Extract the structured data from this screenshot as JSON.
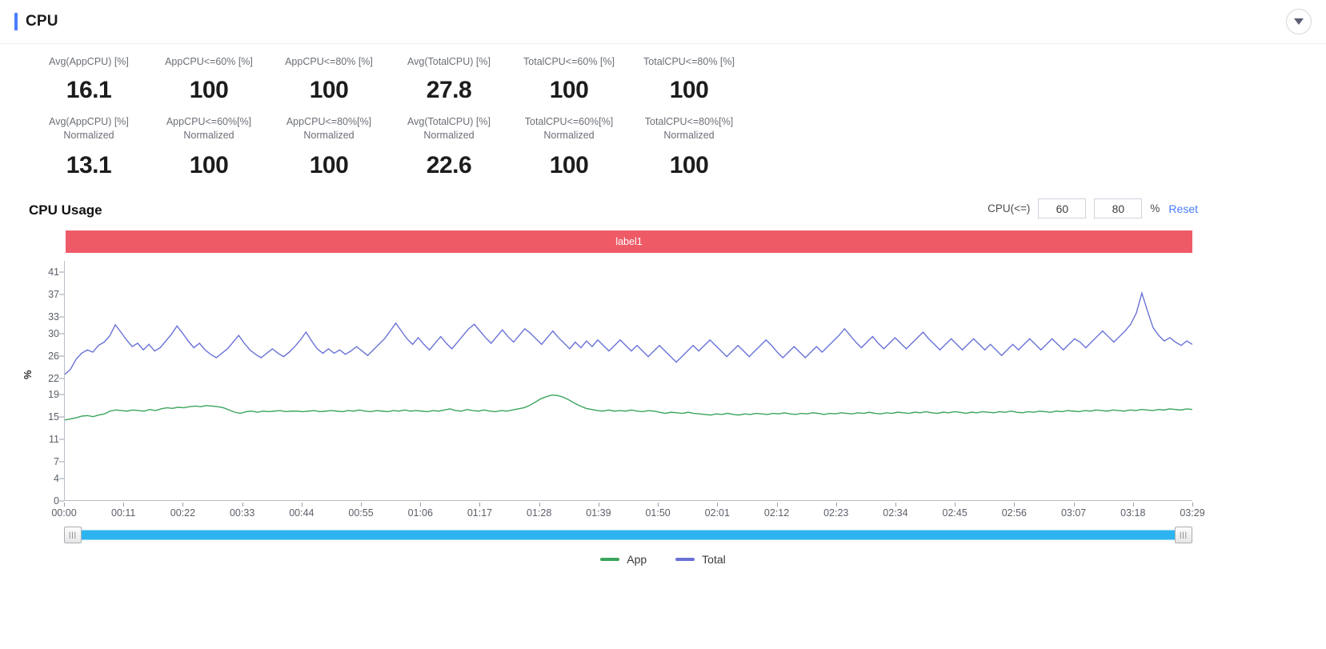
{
  "header": {
    "title": "CPU",
    "collapse_icon": "chevron-down-icon"
  },
  "kpis": {
    "row1": [
      {
        "label": "Avg(AppCPU) [%]",
        "hint": "?",
        "value": "16.1"
      },
      {
        "label": "AppCPU<=60% [%]",
        "value": "100"
      },
      {
        "label": "AppCPU<=80% [%]",
        "value": "100"
      },
      {
        "label": "Avg(TotalCPU) [%]",
        "value": "27.8"
      },
      {
        "label": "TotalCPU<=60% [%]",
        "value": "100"
      },
      {
        "label": "TotalCPU<=80% [%]",
        "value": "100"
      }
    ],
    "row2": [
      {
        "label": "Avg(AppCPU) [%]",
        "label2": "Normalized",
        "hint": "?",
        "value": "13.1"
      },
      {
        "label": "AppCPU<=60%[%]",
        "label2": "Normalized",
        "value": "100"
      },
      {
        "label": "AppCPU<=80%[%]",
        "label2": "Normalized",
        "value": "100"
      },
      {
        "label": "Avg(TotalCPU) [%]",
        "label2": "Normalized",
        "value": "22.6"
      },
      {
        "label": "TotalCPU<=60%[%]",
        "label2": "Normalized",
        "value": "100"
      },
      {
        "label": "TotalCPU<=80%[%]",
        "label2": "Normalized",
        "value": "100"
      }
    ]
  },
  "usage": {
    "title": "CPU Usage",
    "threshold_label": "CPU(<=)",
    "threshold_low": "60",
    "threshold_high": "80",
    "percent_sign": "%",
    "reset_label": "Reset",
    "label_bar_text": "label1",
    "label_bar_color": "#ee5b67"
  },
  "chart_data": {
    "type": "line",
    "title": "CPU Usage",
    "xlabel": "",
    "ylabel": "%",
    "ylim": [
      0,
      43
    ],
    "yticks": [
      41,
      37,
      33,
      30,
      26,
      22,
      19,
      15,
      11,
      7,
      4,
      0
    ],
    "xticks": [
      "00:00",
      "00:11",
      "00:22",
      "00:33",
      "00:44",
      "00:55",
      "01:06",
      "01:17",
      "01:28",
      "01:39",
      "01:50",
      "02:01",
      "02:12",
      "02:23",
      "02:34",
      "02:45",
      "02:56",
      "03:07",
      "03:18",
      "03:29"
    ],
    "grid": false,
    "legend_position": "bottom",
    "colors": {
      "App": "#3ba55d",
      "Total": "#6a72d6"
    },
    "series": [
      {
        "name": "App",
        "color": "#3ba55d",
        "values": [
          14.4,
          14.6,
          14.8,
          15.1,
          15.2,
          15.0,
          15.3,
          15.5,
          16.0,
          16.2,
          16.1,
          16.0,
          16.2,
          16.1,
          16.0,
          16.3,
          16.1,
          16.4,
          16.6,
          16.5,
          16.7,
          16.6,
          16.8,
          16.9,
          16.8,
          17.0,
          16.9,
          16.8,
          16.6,
          16.2,
          15.8,
          15.6,
          15.9,
          16.0,
          15.8,
          16.0,
          15.9,
          16.0,
          16.1,
          15.9,
          16.0,
          16.0,
          15.9,
          16.0,
          16.1,
          15.9,
          16.0,
          16.1,
          16.0,
          15.9,
          16.1,
          16.0,
          16.2,
          16.0,
          15.9,
          16.1,
          16.0,
          15.9,
          16.1,
          16.0,
          16.2,
          16.0,
          16.1,
          16.0,
          15.9,
          16.1,
          16.0,
          16.2,
          16.4,
          16.1,
          16.0,
          16.3,
          16.1,
          16.0,
          16.2,
          16.0,
          15.9,
          16.1,
          16.0,
          16.2,
          16.4,
          16.6,
          17.0,
          17.6,
          18.2,
          18.6,
          18.9,
          18.8,
          18.5,
          18.0,
          17.4,
          16.9,
          16.5,
          16.3,
          16.1,
          16.0,
          16.2,
          16.0,
          16.1,
          16.0,
          16.2,
          16.0,
          15.9,
          16.1,
          16.0,
          15.8,
          15.6,
          15.8,
          15.7,
          15.6,
          15.8,
          15.6,
          15.5,
          15.4,
          15.3,
          15.5,
          15.4,
          15.6,
          15.4,
          15.3,
          15.5,
          15.4,
          15.6,
          15.5,
          15.4,
          15.6,
          15.5,
          15.7,
          15.5,
          15.4,
          15.6,
          15.5,
          15.7,
          15.6,
          15.4,
          15.6,
          15.5,
          15.7,
          15.6,
          15.5,
          15.7,
          15.6,
          15.8,
          15.6,
          15.5,
          15.7,
          15.6,
          15.8,
          15.7,
          15.6,
          15.8,
          15.7,
          15.9,
          15.7,
          15.6,
          15.8,
          15.7,
          15.9,
          15.8,
          15.6,
          15.8,
          15.7,
          15.9,
          15.8,
          15.7,
          15.9,
          15.8,
          16.0,
          15.8,
          15.7,
          15.9,
          15.8,
          16.0,
          15.9,
          15.8,
          16.0,
          15.9,
          16.1,
          16.0,
          15.9,
          16.1,
          16.0,
          16.2,
          16.1,
          16.0,
          16.2,
          16.1,
          16.0,
          16.2,
          16.1,
          16.3,
          16.2,
          16.1,
          16.3,
          16.2,
          16.4,
          16.3,
          16.2,
          16.4,
          16.3
        ]
      },
      {
        "name": "Total",
        "color": "#6a72d6",
        "values": [
          22.6,
          23.5,
          25.3,
          26.4,
          27.0,
          26.6,
          27.8,
          28.4,
          29.5,
          31.5,
          30.2,
          28.8,
          27.6,
          28.2,
          27.0,
          28.0,
          26.8,
          27.4,
          28.6,
          29.8,
          31.3,
          30.0,
          28.6,
          27.4,
          28.2,
          27.0,
          26.2,
          25.6,
          26.4,
          27.2,
          28.4,
          29.6,
          28.2,
          27.0,
          26.2,
          25.6,
          26.4,
          27.2,
          26.4,
          25.8,
          26.6,
          27.6,
          28.8,
          30.2,
          28.6,
          27.2,
          26.4,
          27.2,
          26.4,
          27.0,
          26.2,
          26.8,
          27.6,
          26.8,
          26.0,
          27.0,
          28.0,
          29.0,
          30.4,
          31.8,
          30.4,
          29.0,
          28.0,
          29.2,
          28.0,
          27.0,
          28.2,
          29.4,
          28.2,
          27.2,
          28.4,
          29.6,
          30.8,
          31.6,
          30.4,
          29.2,
          28.2,
          29.4,
          30.6,
          29.4,
          28.4,
          29.6,
          30.8,
          30.0,
          29.0,
          28.0,
          29.2,
          30.4,
          29.2,
          28.2,
          27.2,
          28.4,
          27.4,
          28.6,
          27.6,
          28.8,
          27.8,
          26.8,
          27.8,
          28.8,
          27.8,
          26.8,
          27.8,
          26.8,
          25.8,
          26.8,
          27.8,
          26.8,
          25.8,
          24.8,
          25.8,
          26.8,
          27.8,
          26.8,
          27.8,
          28.8,
          27.8,
          26.8,
          25.8,
          26.8,
          27.8,
          26.8,
          25.8,
          26.8,
          27.8,
          28.8,
          27.8,
          26.6,
          25.6,
          26.6,
          27.6,
          26.6,
          25.6,
          26.6,
          27.6,
          26.6,
          27.6,
          28.6,
          29.6,
          30.8,
          29.6,
          28.4,
          27.4,
          28.4,
          29.4,
          28.2,
          27.2,
          28.2,
          29.2,
          28.2,
          27.2,
          28.2,
          29.2,
          30.2,
          29.0,
          28.0,
          27.0,
          28.0,
          29.0,
          28.0,
          27.0,
          28.0,
          29.0,
          28.0,
          27.0,
          28.0,
          27.0,
          26.0,
          27.0,
          28.0,
          27.0,
          28.0,
          29.0,
          28.0,
          27.0,
          28.0,
          29.0,
          28.0,
          27.0,
          28.0,
          29.0,
          28.4,
          27.4,
          28.4,
          29.4,
          30.4,
          29.4,
          28.4,
          29.4,
          30.4,
          31.6,
          33.6,
          37.2,
          34.0,
          31.0,
          29.6,
          28.6,
          29.2,
          28.4,
          27.8,
          28.6,
          28.0
        ]
      }
    ]
  },
  "slider": {
    "left_handle": "grip-handle",
    "right_handle": "grip-handle",
    "track_color": "#2db4f0"
  },
  "legend": [
    {
      "name": "App",
      "color": "#3ba55d"
    },
    {
      "name": "Total",
      "color": "#6a72d6"
    }
  ]
}
